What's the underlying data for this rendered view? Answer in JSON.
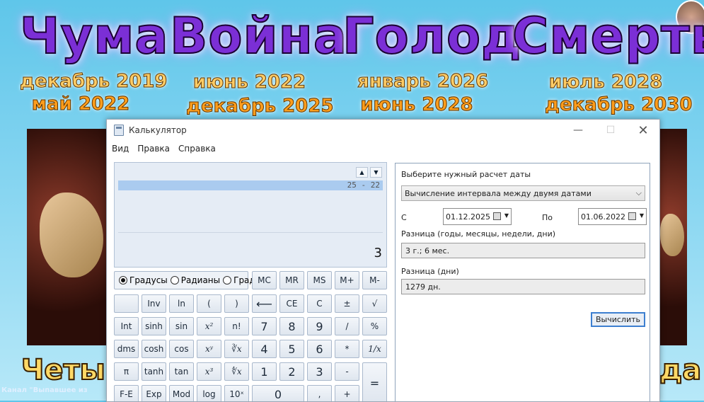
{
  "poster": {
    "titles": [
      "Чума",
      "Война",
      "Голод",
      "Смерть"
    ],
    "dates": [
      [
        "декабрь 2019",
        "май 2022"
      ],
      [
        "июнь 2022",
        "декабрь 2025"
      ],
      [
        "январь 2026",
        "июнь 2028"
      ],
      [
        "июль 2028",
        "декабрь 2030"
      ]
    ],
    "bottom_left": "Четыр",
    "bottom_right": "да",
    "footer_small": "Канал \"Выпавшее из"
  },
  "window": {
    "title": "Калькулятор",
    "min_icon": "minimize-icon",
    "max_icon": "maximize-icon",
    "close_icon": "close-icon",
    "menu": [
      "Вид",
      "Правка",
      "Справка"
    ]
  },
  "calculator": {
    "expression": "25 - 22",
    "result": "3",
    "radios": [
      {
        "label": "Градусы",
        "selected": true
      },
      {
        "label": "Радианы",
        "selected": false
      },
      {
        "label": "Грады",
        "selected": false
      }
    ],
    "memory": [
      "MC",
      "MR",
      "MS",
      "M+",
      "M-"
    ],
    "rows": [
      [
        "",
        "Inv",
        "ln",
        "(",
        ")",
        "⟵",
        "CE",
        "C",
        "±",
        "√"
      ],
      [
        "Int",
        "sinh",
        "sin",
        "x²",
        "n!",
        "7",
        "8",
        "9",
        "/",
        "%"
      ],
      [
        "dms",
        "cosh",
        "cos",
        "xʸ",
        "∛x",
        "4",
        "5",
        "6",
        "*",
        "1/x"
      ],
      [
        "π",
        "tanh",
        "tan",
        "x³",
        "∜x",
        "1",
        "2",
        "3",
        "-",
        "="
      ],
      [
        "F-E",
        "Exp",
        "Mod",
        "log",
        "10ˣ",
        "0",
        ",",
        "+"
      ]
    ]
  },
  "date_panel": {
    "heading": "Выберите нужный расчет даты",
    "mode": "Вычисление интервала между двумя датами",
    "from_label": "С",
    "from_value": "01.12.2025",
    "to_label": "По",
    "to_value": "01.06.2022",
    "diff_label": "Разница (годы, месяцы, недели, дни)",
    "diff_value": "3 г.; 6 мес.",
    "days_label": "Разница (дни)",
    "days_value": "1279 дн.",
    "calc_button": "Вычислить"
  }
}
